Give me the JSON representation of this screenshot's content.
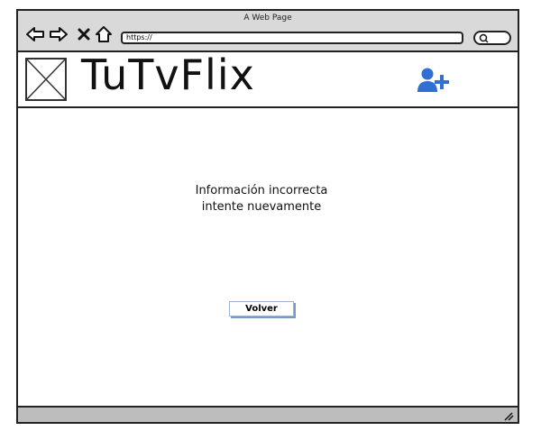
{
  "window": {
    "title": "A Web Page",
    "url": "https://"
  },
  "header": {
    "brand": "TuTvFlix",
    "logo_icon": "image-placeholder-icon",
    "add_user_icon": "user-plus-icon",
    "accent_color": "#2f6fd6"
  },
  "nav": {
    "back_icon": "arrow-left-icon",
    "forward_icon": "arrow-right-icon",
    "close_icon": "close-icon",
    "home_icon": "home-icon",
    "search_icon": "search-icon"
  },
  "main": {
    "message_line1": "Información incorrecta",
    "message_line2": "intente nuevamente",
    "button_label": "Volver"
  }
}
